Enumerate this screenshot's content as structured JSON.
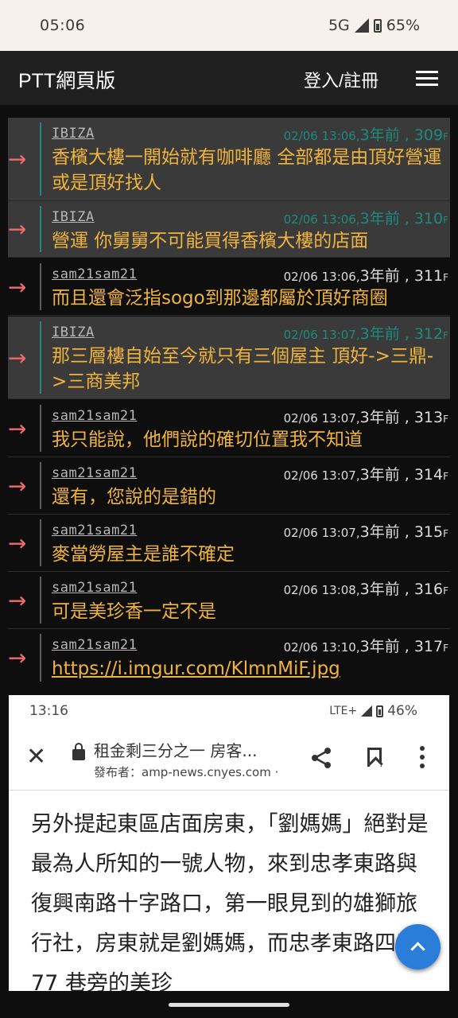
{
  "status_bar": {
    "time": "05:06",
    "network": "5G",
    "battery": "65%",
    "icons": [
      "signal-icon",
      "battery-icon"
    ]
  },
  "app_bar": {
    "title": "PTT網頁版",
    "login_label": "登入/註冊",
    "menu_icon": "hamburger-menu-icon"
  },
  "pushes": [
    {
      "tag": "→",
      "user": "IBIZA",
      "date": "02/06 13:06,",
      "relative": "3年前",
      "floor": "309",
      "floor_suffix": "F",
      "content": "香檳大樓一開始就有咖啡廳 全部都是由頂好營運或是頂好找人",
      "highlighted": true
    },
    {
      "tag": "→",
      "user": "IBIZA",
      "date": "02/06 13:06,",
      "relative": "3年前",
      "floor": "310",
      "floor_suffix": "F",
      "content": "營運 你舅舅不可能買得香檳大樓的店面",
      "highlighted": true
    },
    {
      "tag": "→",
      "user": "sam21sam21",
      "date": "02/06 13:06,",
      "relative": "3年前",
      "floor": "311",
      "floor_suffix": "F",
      "content": "而且還會泛指sogo到那邊都屬於頂好商圈",
      "highlighted": false
    },
    {
      "tag": "→",
      "user": "IBIZA",
      "date": "02/06 13:07,",
      "relative": "3年前",
      "floor": "312",
      "floor_suffix": "F",
      "content": "那三層樓自始至今就只有三個屋主 頂好->三鼎->三商美邦",
      "highlighted": true
    },
    {
      "tag": "→",
      "user": "sam21sam21",
      "date": "02/06 13:07,",
      "relative": "3年前",
      "floor": "313",
      "floor_suffix": "F",
      "content": "我只能說，他們說的確切位置我不知道",
      "highlighted": false
    },
    {
      "tag": "→",
      "user": "sam21sam21",
      "date": "02/06 13:07,",
      "relative": "3年前",
      "floor": "314",
      "floor_suffix": "F",
      "content": "還有，您說的是錯的",
      "highlighted": false
    },
    {
      "tag": "→",
      "user": "sam21sam21",
      "date": "02/06 13:07,",
      "relative": "3年前",
      "floor": "315",
      "floor_suffix": "F",
      "content": "麥當勞屋主是誰不確定",
      "highlighted": false
    },
    {
      "tag": "→",
      "user": "sam21sam21",
      "date": "02/06 13:08,",
      "relative": "3年前",
      "floor": "316",
      "floor_suffix": "F",
      "content": "可是美珍香一定不是",
      "highlighted": false
    },
    {
      "tag": "→",
      "user": "sam21sam21",
      "date": "02/06 13:10,",
      "relative": "3年前",
      "floor": "317",
      "floor_suffix": "F",
      "content": "https://i.imgur.com/KlmnMiF.jpg",
      "highlighted": false,
      "is_link": true
    }
  ],
  "embedded_screenshot": {
    "time": "13:16",
    "network": "LTE+",
    "battery": "46%",
    "page_title": "租金剩三分之一 房客...",
    "publisher": "發布者：amp-news.cnyes.com ·",
    "article_text": "另外提起東區店面房東，「劉媽媽」絕對是最為人所知的一號人物，來到忠孝東路與復興南路十字路口，第一眼見到的雄獅旅行社，房東就是劉媽媽，而忠孝東路四段 77 巷旁的美珍"
  },
  "colors": {
    "push_text": "#f0b33c",
    "arrow": "#f06a6a",
    "highlight_bg": "#3a3a3a",
    "highlight_meta": "#1e8a7d",
    "fab": "#2a7dd9"
  }
}
